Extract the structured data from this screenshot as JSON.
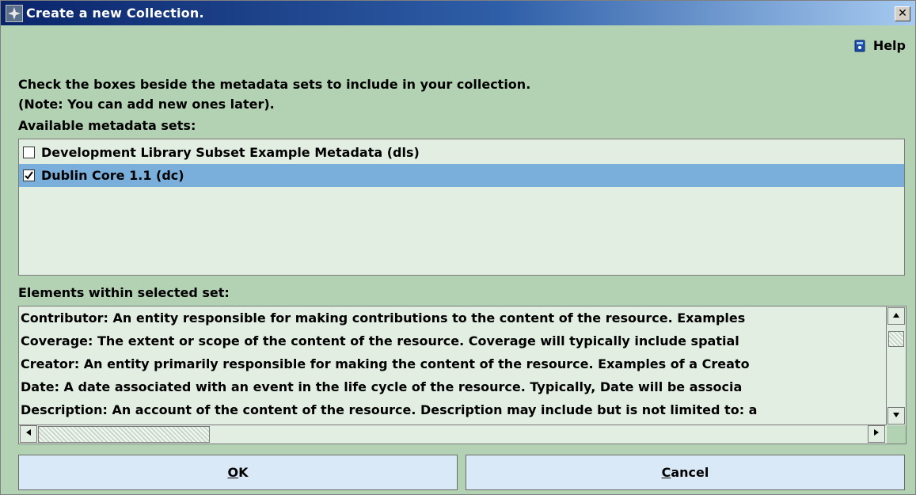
{
  "window": {
    "title": "Create a new Collection.",
    "close_glyph": "✕"
  },
  "help": {
    "label": "Help",
    "icon": "help-book-icon"
  },
  "instructions": {
    "line1": "Check the boxes beside the metadata sets to include in your collection.",
    "line2": "(Note: You can add new ones later)."
  },
  "available": {
    "label": "Available metadata sets:",
    "items": [
      {
        "label": "Development Library Subset Example Metadata (dls)",
        "checked": false,
        "selected": false
      },
      {
        "label": "Dublin Core 1.1 (dc)",
        "checked": true,
        "selected": true
      }
    ]
  },
  "elements": {
    "label": "Elements within selected set:",
    "lines": [
      "Contributor: An entity responsible for making contributions to the content of the resource. Examples",
      "Coverage: The extent or scope of the content of the resource. Coverage will typically include spatial",
      "Creator: An entity primarily responsible for making the content of the resource. Examples of a Creato",
      "Date: A date associated with an event in the life cycle of the resource. Typically, Date will be associa",
      "Description: An account of the content of the resource. Description may include but is not limited to: a"
    ]
  },
  "buttons": {
    "ok": {
      "mnemonic": "O",
      "rest": "K"
    },
    "cancel": {
      "mnemonic": "C",
      "rest": "ancel"
    }
  },
  "colors": {
    "accent": "#0a246a",
    "panel": "#b3d1b3",
    "selection": "#7aaedb",
    "button": "#d9e9f7"
  }
}
